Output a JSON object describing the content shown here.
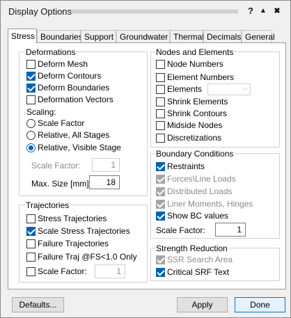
{
  "window": {
    "title": "Display Options"
  },
  "titlebar": {
    "help": "?",
    "collapse": "▲",
    "close": "✖"
  },
  "tabs": [
    "Stress",
    "Boundaries",
    "Support",
    "Groundwater",
    "Thermal",
    "Decimals",
    "General"
  ],
  "deformations": {
    "title": "Deformations",
    "items": [
      {
        "label": "Deform Mesh",
        "checked": false
      },
      {
        "label": "Deform Contours",
        "checked": true
      },
      {
        "label": "Deform Boundaries",
        "checked": true
      },
      {
        "label": "Deformation Vectors",
        "checked": false
      }
    ],
    "scaling_label": "Scaling:",
    "scaling_options": [
      {
        "label": "Scale Factor",
        "checked": false
      },
      {
        "label": "Relative, All Stages",
        "checked": false
      },
      {
        "label": "Relative, Visible Stage",
        "checked": true
      }
    ],
    "scale_factor_label": "Scale Factor:",
    "scale_factor_value": "1",
    "max_size_label": "Max. Size [mm]:",
    "max_size_value": "18"
  },
  "trajectories": {
    "title": "Trajectories",
    "items": [
      {
        "label": "Stress Trajectories",
        "checked": false
      },
      {
        "label": "Scale Stress Trajectories",
        "checked": true
      },
      {
        "label": "Failure Trajectories",
        "checked": false
      },
      {
        "label": "Failure Traj @FS<1.0 Only",
        "checked": false
      }
    ],
    "scale_factor_label": "Scale Factor:",
    "scale_factor_value": "1"
  },
  "nodes_elements": {
    "title": "Nodes and Elements",
    "items": [
      {
        "label": "Node Numbers",
        "checked": false
      },
      {
        "label": "Element Numbers",
        "checked": false
      },
      {
        "label": "Elements",
        "checked": false
      },
      {
        "label": "Shrink Elements",
        "checked": false
      },
      {
        "label": "Shrink Contours",
        "checked": false
      },
      {
        "label": "Midside Nodes",
        "checked": false
      },
      {
        "label": "Discretizations",
        "checked": false
      }
    ],
    "elements_combo_value": ""
  },
  "boundary_conditions": {
    "title": "Boundary Conditions",
    "items": [
      {
        "label": "Restraints",
        "checked": true,
        "disabled": false
      },
      {
        "label": "Forces\\Line Loads",
        "checked": true,
        "disabled": true
      },
      {
        "label": "Distributed Loads",
        "checked": true,
        "disabled": true
      },
      {
        "label": "Liner Moments, Hinges",
        "checked": true,
        "disabled": true
      },
      {
        "label": "Show BC values",
        "checked": true,
        "disabled": false
      }
    ],
    "scale_factor_label": "Scale Factor:",
    "scale_factor_value": "1"
  },
  "strength_reduction": {
    "title": "Strength Reduction",
    "items": [
      {
        "label": "SSR Search Area",
        "checked": true,
        "disabled": true
      },
      {
        "label": "Critical SRF Text",
        "checked": true,
        "disabled": false
      }
    ]
  },
  "buttons": {
    "defaults": "Defaults...",
    "apply": "Apply",
    "done": "Done"
  },
  "colors": {
    "accent": "#0063b1",
    "disabled_check": "#a6a6a6",
    "panel": "#ffffff",
    "chrome": "#f0f0f0"
  }
}
